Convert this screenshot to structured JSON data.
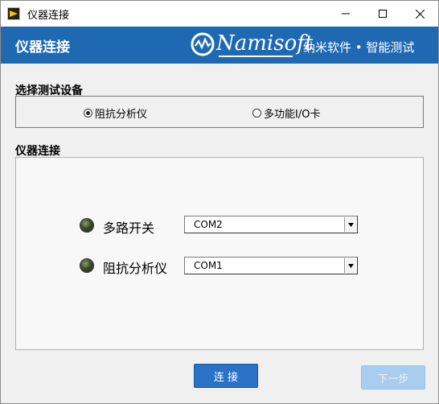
{
  "window": {
    "title": "仪器连接",
    "controls": {
      "minimize": "minimize",
      "maximize": "maximize",
      "close": "close"
    }
  },
  "header": {
    "title": "仪器连接",
    "brand": "Namisoft",
    "tagline": "纳米软件 • 智能测试",
    "color": "#1f68b2"
  },
  "device_select": {
    "label": "选择测试设备",
    "options": [
      {
        "label": "阻抗分析仪",
        "checked": true
      },
      {
        "label": "多功能I/O卡",
        "checked": false
      }
    ]
  },
  "connection": {
    "label": "仪器连接",
    "rows": [
      {
        "label": "多路开关",
        "port": "COM2"
      },
      {
        "label": "阻抗分析仪",
        "port": "COM1"
      }
    ]
  },
  "buttons": {
    "connect": "连  接",
    "next": "下一步"
  }
}
